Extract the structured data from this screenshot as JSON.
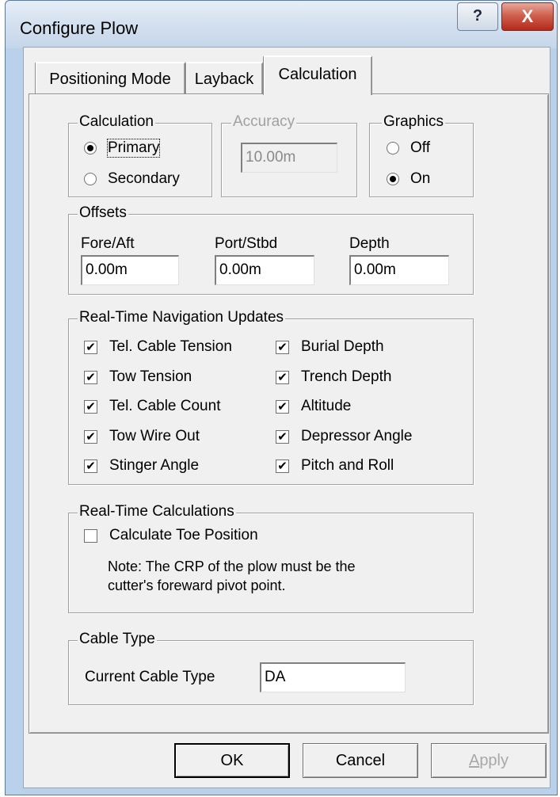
{
  "window": {
    "title": "Configure Plow",
    "help_label": "?",
    "close_label": "X"
  },
  "tabs": [
    "Positioning Mode",
    "Layback",
    "Calculation"
  ],
  "active_tab": "Calculation",
  "calculation": {
    "title": "Calculation",
    "primary": "Primary",
    "secondary": "Secondary",
    "selected": "Primary"
  },
  "accuracy": {
    "title": "Accuracy",
    "value": "10.00m"
  },
  "graphics": {
    "title": "Graphics",
    "off": "Off",
    "on": "On",
    "selected": "On"
  },
  "offsets": {
    "title": "Offsets",
    "fore_aft_label": "Fore/Aft",
    "fore_aft_value": "0.00m",
    "port_stbd_label": "Port/Stbd",
    "port_stbd_value": "0.00m",
    "depth_label": "Depth",
    "depth_value": "0.00m"
  },
  "nav_updates": {
    "title": "Real-Time Navigation Updates",
    "left": [
      {
        "label": "Tel. Cable Tension",
        "checked": true
      },
      {
        "label": "Tow Tension",
        "checked": true
      },
      {
        "label": "Tel. Cable Count",
        "checked": true
      },
      {
        "label": "Tow Wire Out",
        "checked": true
      },
      {
        "label": "Stinger Angle",
        "checked": true
      }
    ],
    "right": [
      {
        "label": "Burial Depth",
        "checked": true
      },
      {
        "label": "Trench Depth",
        "checked": true
      },
      {
        "label": "Altitude",
        "checked": true
      },
      {
        "label": "Depressor Angle",
        "checked": true
      },
      {
        "label": "Pitch and Roll",
        "checked": true
      }
    ]
  },
  "calculations": {
    "title": "Real-Time Calculations",
    "toe_label": "Calculate Toe Position",
    "toe_checked": false,
    "note_line1": "Note: The CRP of the plow must be the",
    "note_line2": "cutter's foreward pivot point."
  },
  "cable_type": {
    "title": "Cable Type",
    "label": "Current Cable Type",
    "value": "DA"
  },
  "buttons": {
    "ok": "OK",
    "cancel": "Cancel",
    "apply": "Apply"
  },
  "check_glyph": "✔"
}
